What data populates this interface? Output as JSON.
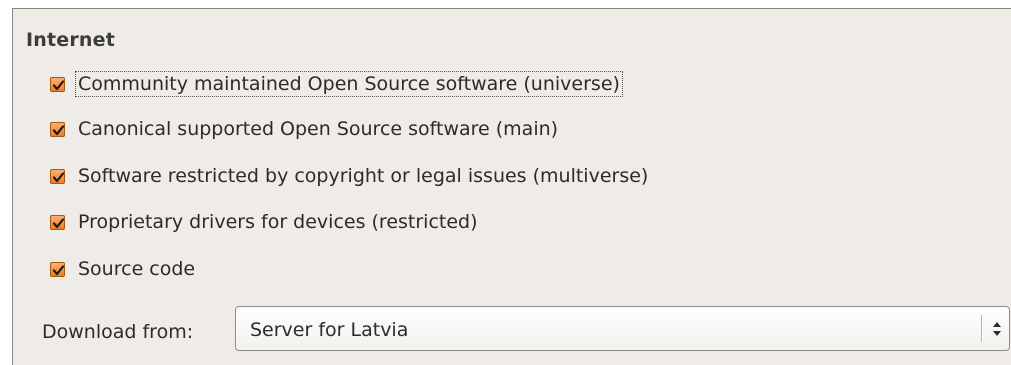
{
  "section": {
    "title": "Internet"
  },
  "components": [
    {
      "label": "Community maintained Open Source software (universe)",
      "checked": true,
      "focused": true
    },
    {
      "label": "Canonical supported Open Source software (main)",
      "checked": true,
      "focused": false
    },
    {
      "label": "Software restricted by copyright or legal issues (multiverse)",
      "checked": true,
      "focused": false
    },
    {
      "label": "Proprietary drivers for devices (restricted)",
      "checked": true,
      "focused": false
    },
    {
      "label": "Source code",
      "checked": true,
      "focused": false
    }
  ],
  "download": {
    "label": "Download from:",
    "selected": "Server for Latvia"
  },
  "colors": {
    "checkbox_fill": "#f07d25",
    "panel_bg": "#efebe7"
  },
  "icons": {
    "checkbox": "checkmark-icon",
    "combo": "up-down-arrows-icon"
  }
}
